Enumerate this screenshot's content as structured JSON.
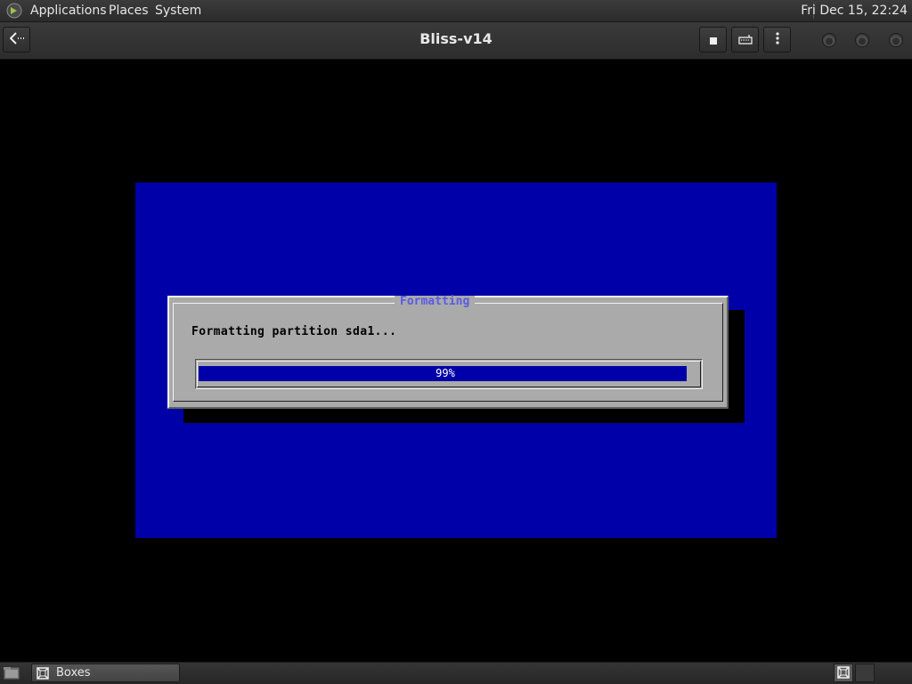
{
  "top_panel": {
    "menus": [
      "Applications",
      "Places",
      "System"
    ],
    "clock": "Fri Dec 15, 22:24",
    "logo_icon": "mate-logo-icon"
  },
  "window": {
    "title": "Bliss-v14",
    "buttons": {
      "back_icon": "back-arrow-icon",
      "stop_icon": "stop-icon",
      "keyboard_icon": "keyboard-icon",
      "menu_icon": "kebab-menu-icon"
    },
    "controls": [
      "minimize",
      "maximize",
      "close"
    ]
  },
  "vm": {
    "dialog": {
      "title": "Formatting",
      "message": "Formatting partition sda1...",
      "progress": {
        "value": 99,
        "label": "99%"
      }
    },
    "colors": {
      "screen": "#0000a8",
      "dialog": "#aaaaaa",
      "title_text": "#5a5ae6"
    }
  },
  "bottom_panel": {
    "show_desktop_icon": "show-desktop-icon",
    "tasks": [
      {
        "label": "Boxes",
        "icon": "boxes-icon"
      }
    ],
    "workspace_icon": "workspace-switcher-icon"
  }
}
